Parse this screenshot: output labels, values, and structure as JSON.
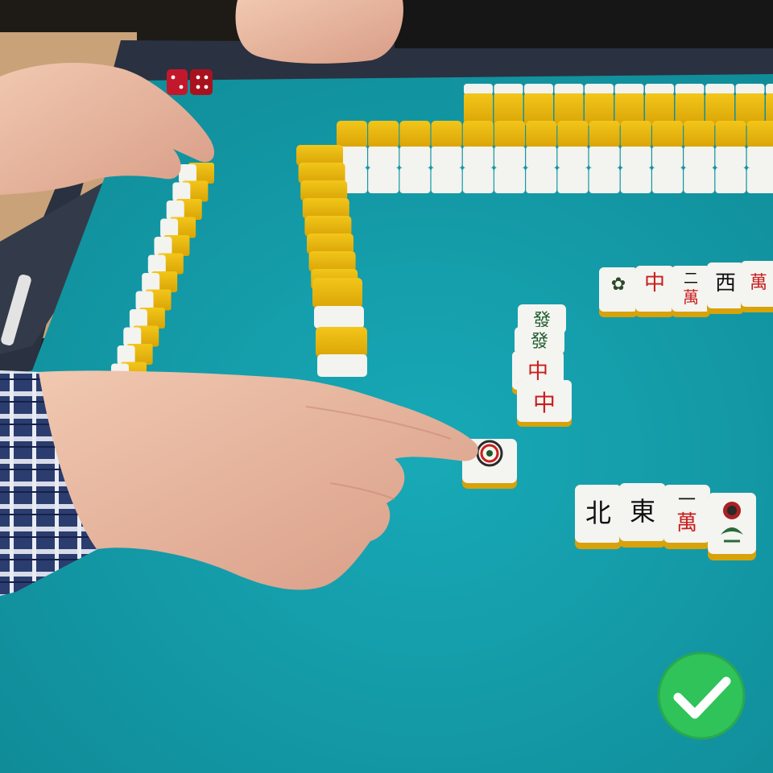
{
  "scene": {
    "kind": "photo",
    "subject": "mahjong-table",
    "colors": {
      "felt": "#17a6b4",
      "felt_shadow": "#0f8593",
      "tile_face": "#f4f4f0",
      "tile_back": "#e8b40e",
      "tray": "#2a3140",
      "badge": "#2fc35a"
    }
  },
  "tiles": {
    "east_discard": "東",
    "wan_one_number": "一",
    "wan_one_suit": "萬",
    "wan_two_number": "二",
    "wan_two_suit": "萬",
    "red_dragon": "中",
    "north_wind": "北",
    "west_wind": "西",
    "green_dragon": "發"
  },
  "badge": {
    "icon": "checkmark-icon",
    "meaning": "correct"
  }
}
